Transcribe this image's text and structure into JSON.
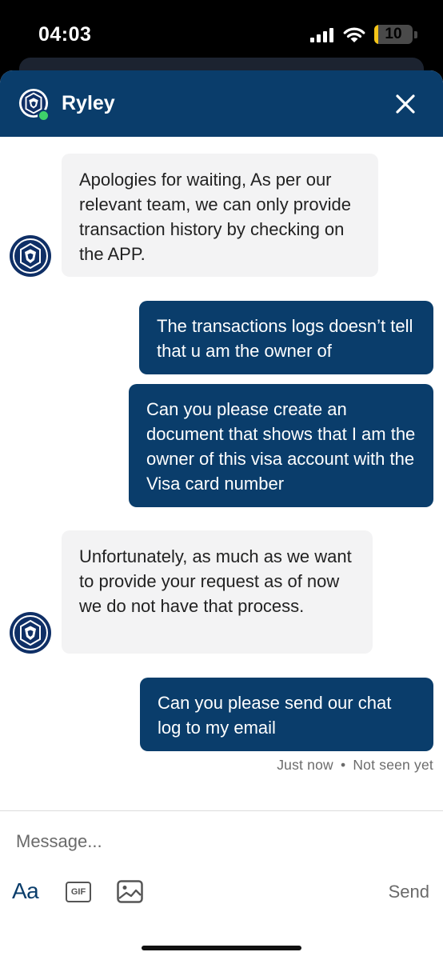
{
  "status_bar": {
    "time": "04:03",
    "battery_level": "10",
    "battery_fraction": 0.1,
    "battery_color": "#f5c518"
  },
  "header": {
    "agent_name": "Ryley",
    "presence_color": "#3ed36a",
    "background_color": "#0a3d6b",
    "avatar_icon": "crypto-lion-logo-icon",
    "close_icon": "close-icon"
  },
  "messages": [
    {
      "from": "agent",
      "text": "Apologies for waiting, As per our relevant team, we can only provide transaction history by checking on the APP."
    },
    {
      "from": "user",
      "text": "The transactions logs doesn’t tell that u am the owner of"
    },
    {
      "from": "user",
      "text": "Can you please create an document that shows that I am the owner of this visa account with the Visa card number"
    },
    {
      "from": "agent",
      "text": "Unfortunately, as much as we want to provide your request as of now we do not have that process."
    },
    {
      "from": "user",
      "text": "Can you please send our chat log to my email"
    }
  ],
  "delivery_status": {
    "time": "Just now",
    "separator": "•",
    "seen": "Not seen yet"
  },
  "composer": {
    "placeholder": "Message...",
    "value": "",
    "format_label": "Aa",
    "gif_label": "GIF",
    "image_icon": "image-icon",
    "send_label": "Send"
  },
  "colors": {
    "accent": "#0a3d6b",
    "agent_bubble": "#f3f3f4",
    "user_bubble": "#0a3d6b"
  }
}
